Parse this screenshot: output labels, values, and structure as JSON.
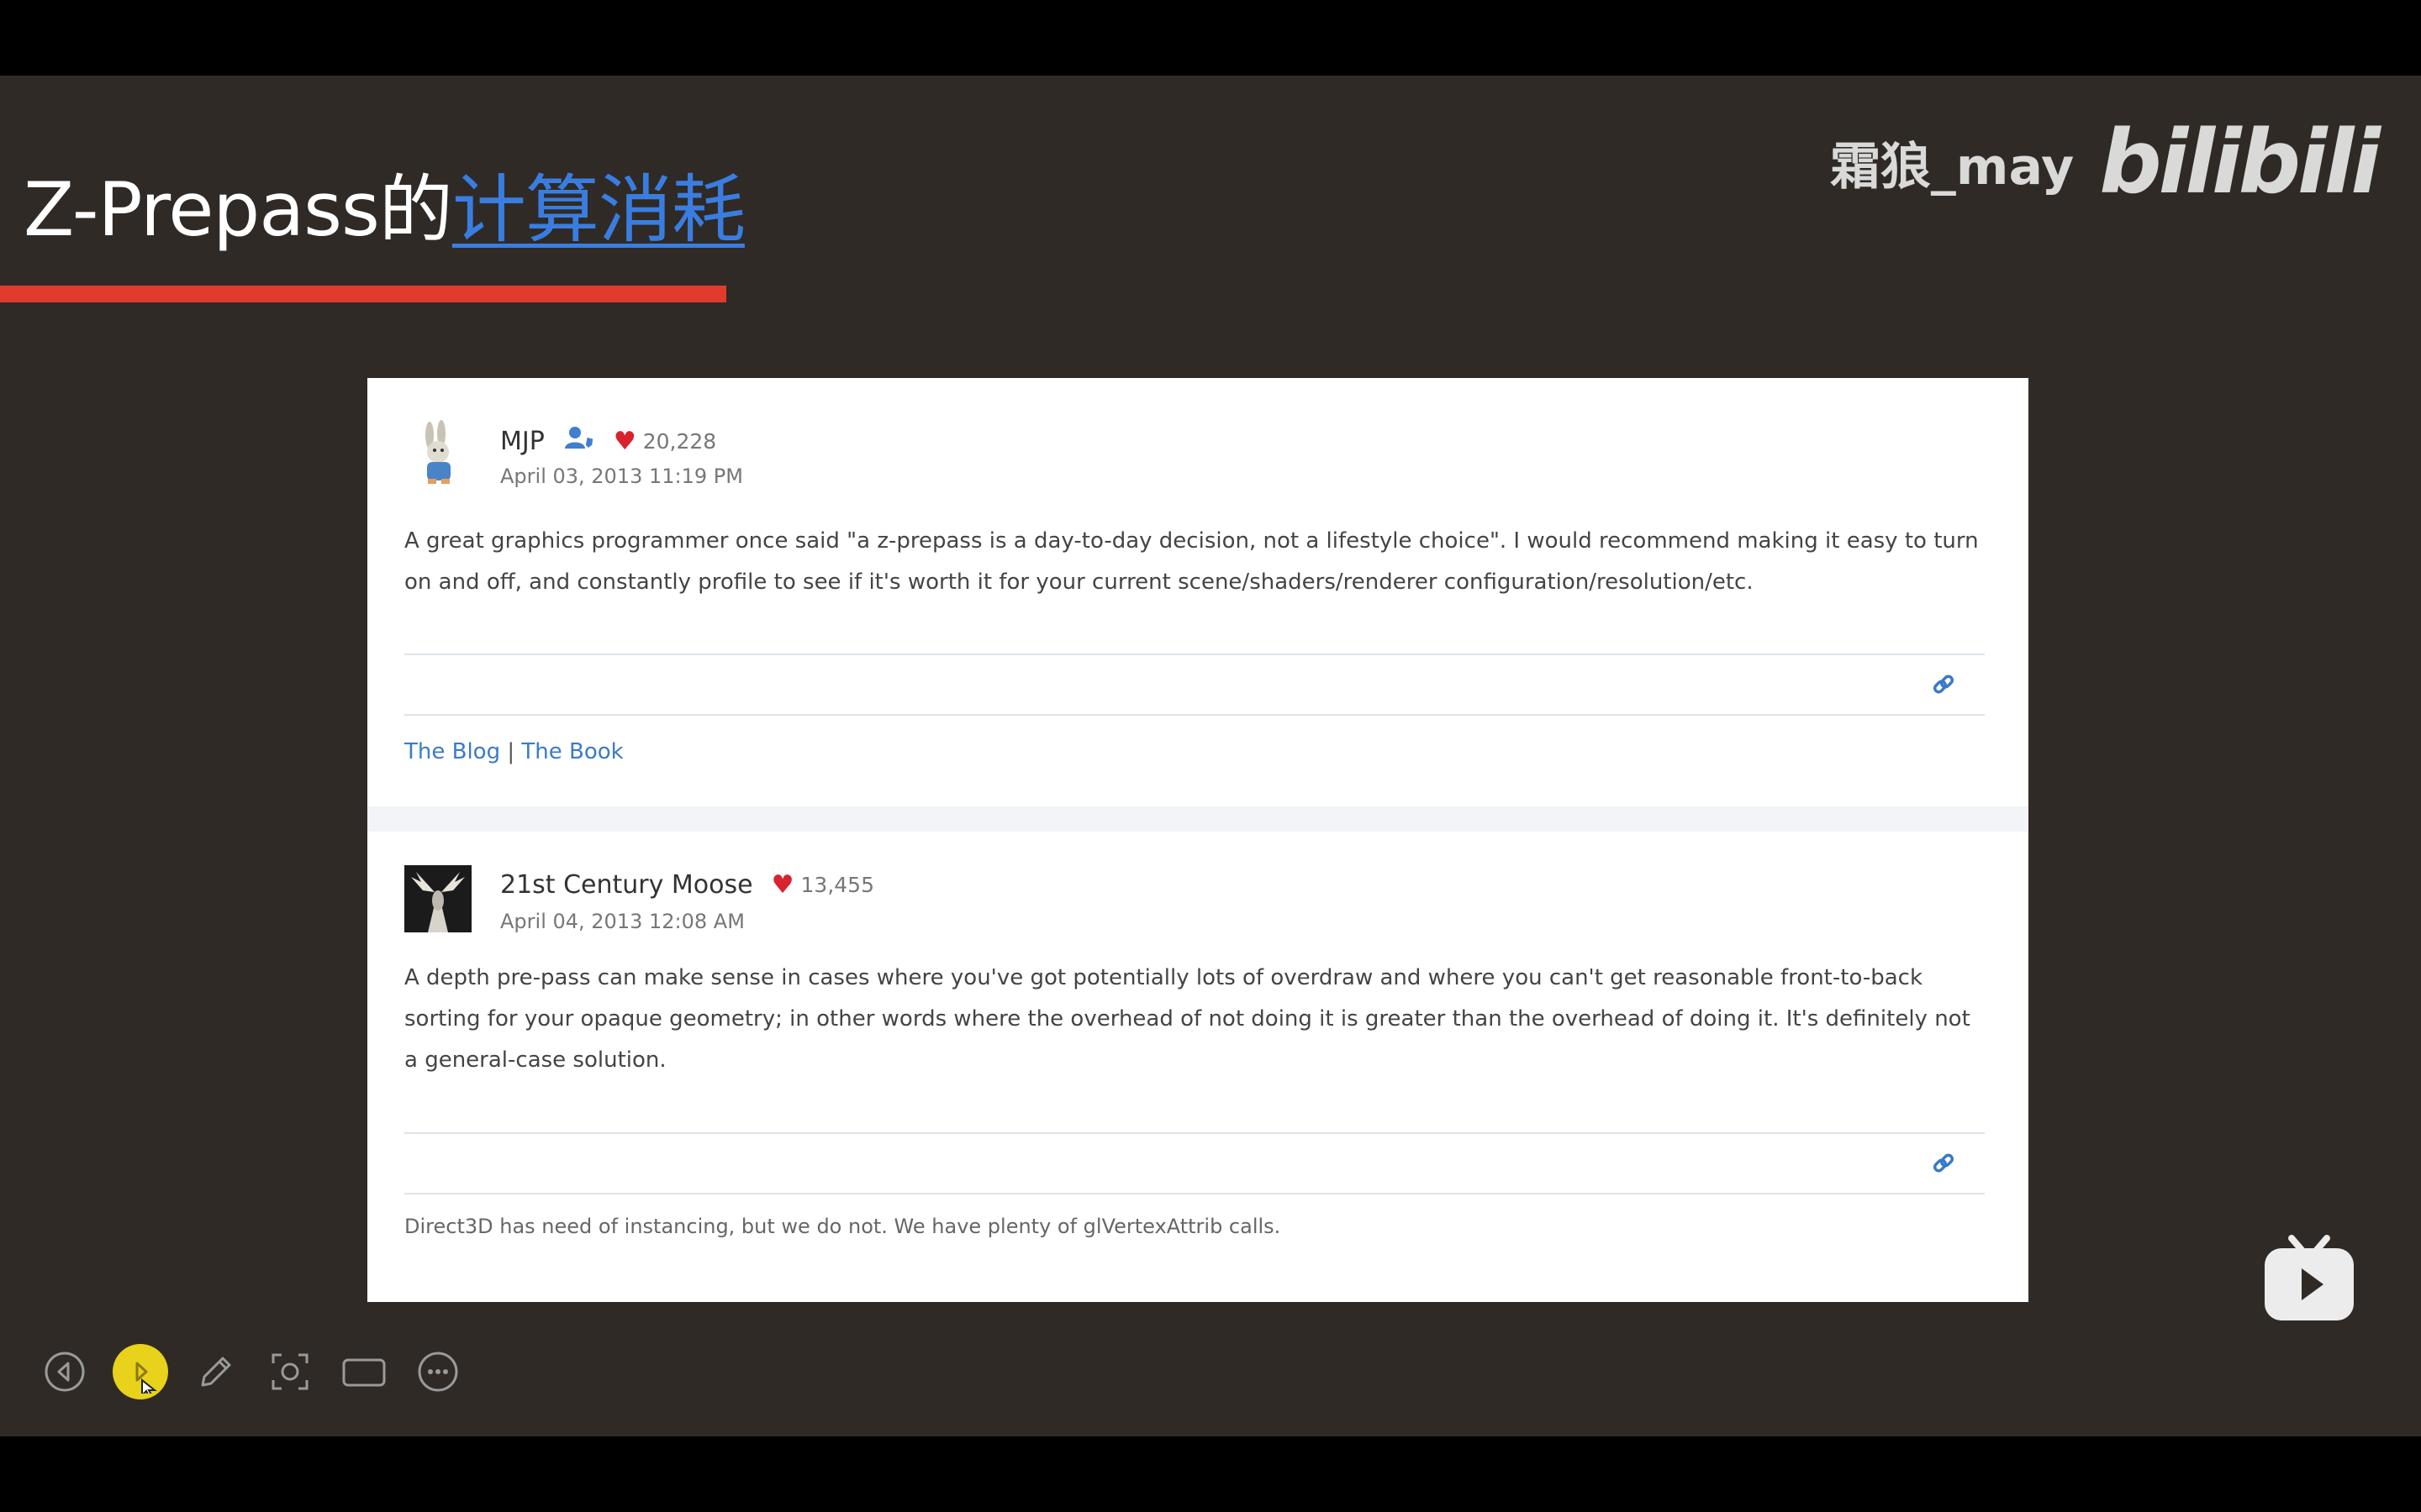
{
  "slide": {
    "title_part1": "Z-Prepass的",
    "title_part2": "计算消耗"
  },
  "watermark": {
    "username": "霜狼_may",
    "logo": "bilibili"
  },
  "posts": [
    {
      "author": "MJP",
      "likes": "20,228",
      "date": "April 03, 2013 11:19 PM",
      "body": "A great graphics programmer once said \"a z-prepass is a day-to-day decision, not a lifestyle choice\". I would recommend making it easy to turn on and off, and constantly profile to see if it's worth it for your current scene/shaders/renderer configuration/resolution/etc.",
      "signature_link1": "The Blog",
      "signature_sep": "|",
      "signature_link2": "The Book"
    },
    {
      "author": "21st Century Moose",
      "likes": "13,455",
      "date": "April 04, 2013 12:08 AM",
      "body": "A depth pre-pass can make sense in cases where you've got potentially lots of overdraw and where you can't get reasonable front-to-back sorting for your opaque geometry; in other words where the overhead of not doing it is greater than the overhead of doing it. It's definitely not a general-case solution.",
      "signature": "Direct3D has need of instancing, but we do not. We have plenty of glVertexAttrib calls."
    }
  ],
  "toolbar": {
    "icons": [
      "previous-icon",
      "next-icon",
      "pen-icon",
      "screenshot-icon",
      "camera-icon",
      "more-icon"
    ]
  },
  "colors": {
    "slide_bg": "#2f2a26",
    "title_highlight": "#3a7de0",
    "red_bar": "#e23a2d",
    "heart": "#d8232f",
    "link": "#3a7bc8",
    "toolbar_active": "#e8d21b"
  }
}
